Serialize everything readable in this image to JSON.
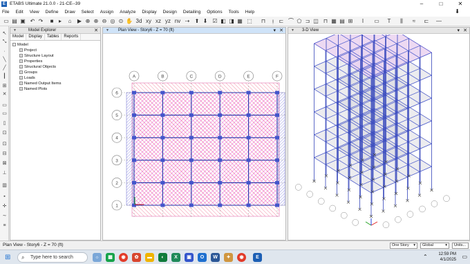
{
  "window": {
    "title": "ETABS Ultimate 21.0.0 - 21-CE--39",
    "app_icon_letter": "E"
  },
  "window_controls": {
    "minimize": "–",
    "maximize": "□",
    "close": "✕"
  },
  "menu": [
    "File",
    "Edit",
    "View",
    "Define",
    "Draw",
    "Select",
    "Assign",
    "Analyze",
    "Display",
    "Design",
    "Detailing",
    "Options",
    "Tools",
    "Help"
  ],
  "explorer": {
    "title": "Model Explorer",
    "tabs": [
      "Model",
      "Display",
      "Tables",
      "Reports"
    ],
    "root": "Model",
    "items": [
      "Project",
      "Structure Layout",
      "Properties",
      "Structural Objects",
      "Groups",
      "Loads",
      "Named Output Items",
      "Named Plots"
    ]
  },
  "plan_view": {
    "title": "Plan View - Story6 - Z = 70 (ft)",
    "grid_letters": [
      "A",
      "B",
      "C",
      "D",
      "E",
      "F"
    ],
    "grid_numbers": [
      "6",
      "5",
      "4",
      "3",
      "2",
      "1"
    ]
  },
  "view3d": {
    "title": "3-D View"
  },
  "status": {
    "text": "Plan View - Story6 - Z = 70 (ft)",
    "story_dropdown": "One Story",
    "coord_dropdown": "Global",
    "units_button": "Units..."
  },
  "taskbar": {
    "search_placeholder": "Type here to search",
    "time": "12:59 PM",
    "date": "4/1/2025"
  },
  "colors": {
    "hatch_magenta": "#e040e0",
    "hatch_pink": "#f06080",
    "grid_blue": "#2233aa",
    "frame_blue": "#4455cc"
  }
}
